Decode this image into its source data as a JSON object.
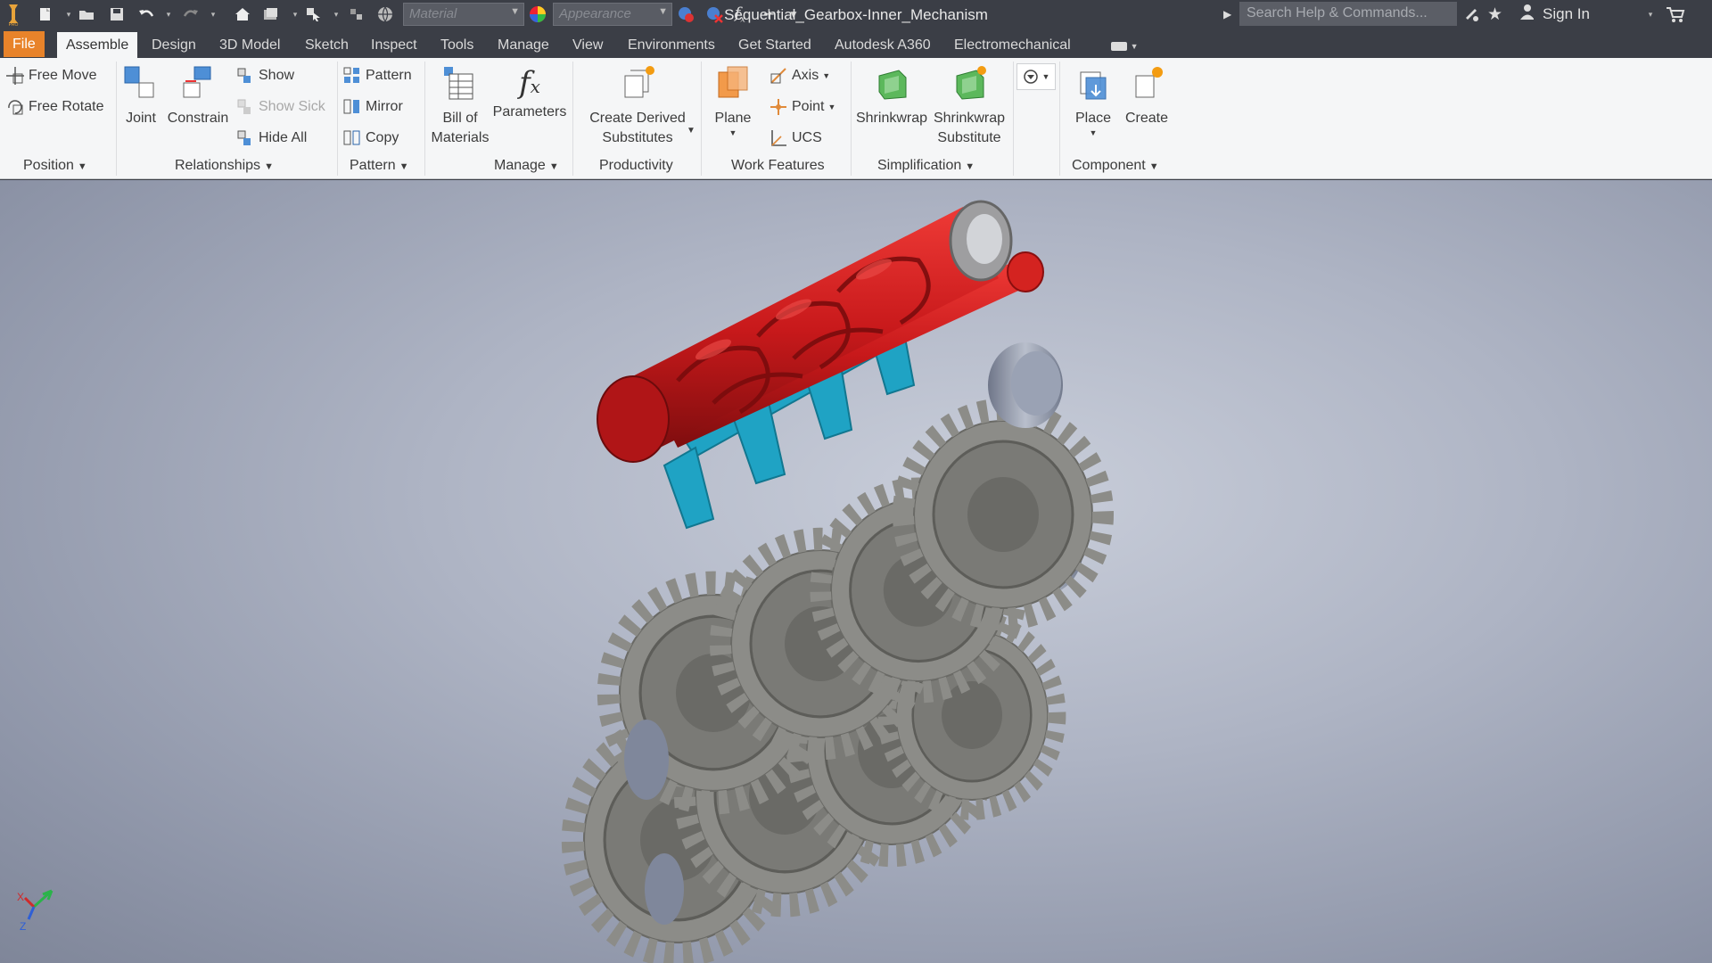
{
  "window": {
    "title": "Sequential_Gearbox-Inner_Mechanism",
    "material_placeholder": "Material",
    "appearance_placeholder": "Appearance",
    "search_placeholder": "Search Help & Commands...",
    "sign_in": "Sign In"
  },
  "tabs": [
    "File",
    "Assemble",
    "Design",
    "3D Model",
    "Sketch",
    "Inspect",
    "Tools",
    "Manage",
    "View",
    "Environments",
    "Get Started",
    "Autodesk A360",
    "Electromechanical"
  ],
  "active_tab": "Assemble",
  "ribbon": {
    "position": {
      "free_move": "Free Move",
      "free_rotate": "Free Rotate",
      "label": "Position"
    },
    "relationships": {
      "joint": "Joint",
      "constrain": "Constrain",
      "show": "Show",
      "show_sick": "Show Sick",
      "hide_all": "Hide All",
      "label": "Relationships"
    },
    "pattern": {
      "pattern": "Pattern",
      "mirror": "Mirror",
      "copy": "Copy",
      "label": "Pattern"
    },
    "manage": {
      "bom_line1": "Bill of",
      "bom_line2": "Materials",
      "parameters": "Parameters",
      "label": "Manage"
    },
    "productivity": {
      "line1": "Create Derived",
      "line2": "Substitutes",
      "label": "Productivity"
    },
    "work_features": {
      "plane": "Plane",
      "axis": "Axis",
      "point": "Point",
      "ucs": "UCS",
      "label": "Work Features"
    },
    "simplification": {
      "shrinkwrap": "Shrinkwrap",
      "sub_line1": "Shrinkwrap",
      "sub_line2": "Substitute",
      "label": "Simplification"
    },
    "component": {
      "place": "Place",
      "create": "Create",
      "label": "Component"
    }
  },
  "axis_triad": {
    "x": "X",
    "z": "Z"
  },
  "colors": {
    "accent_file": "#e8832a",
    "shaft_red": "#c8191b",
    "fork_cyan": "#1fa3c4",
    "gear_gray": "#7b7b78",
    "ribbon_bg": "#f5f6f7",
    "title_bg": "#3b3e46"
  }
}
